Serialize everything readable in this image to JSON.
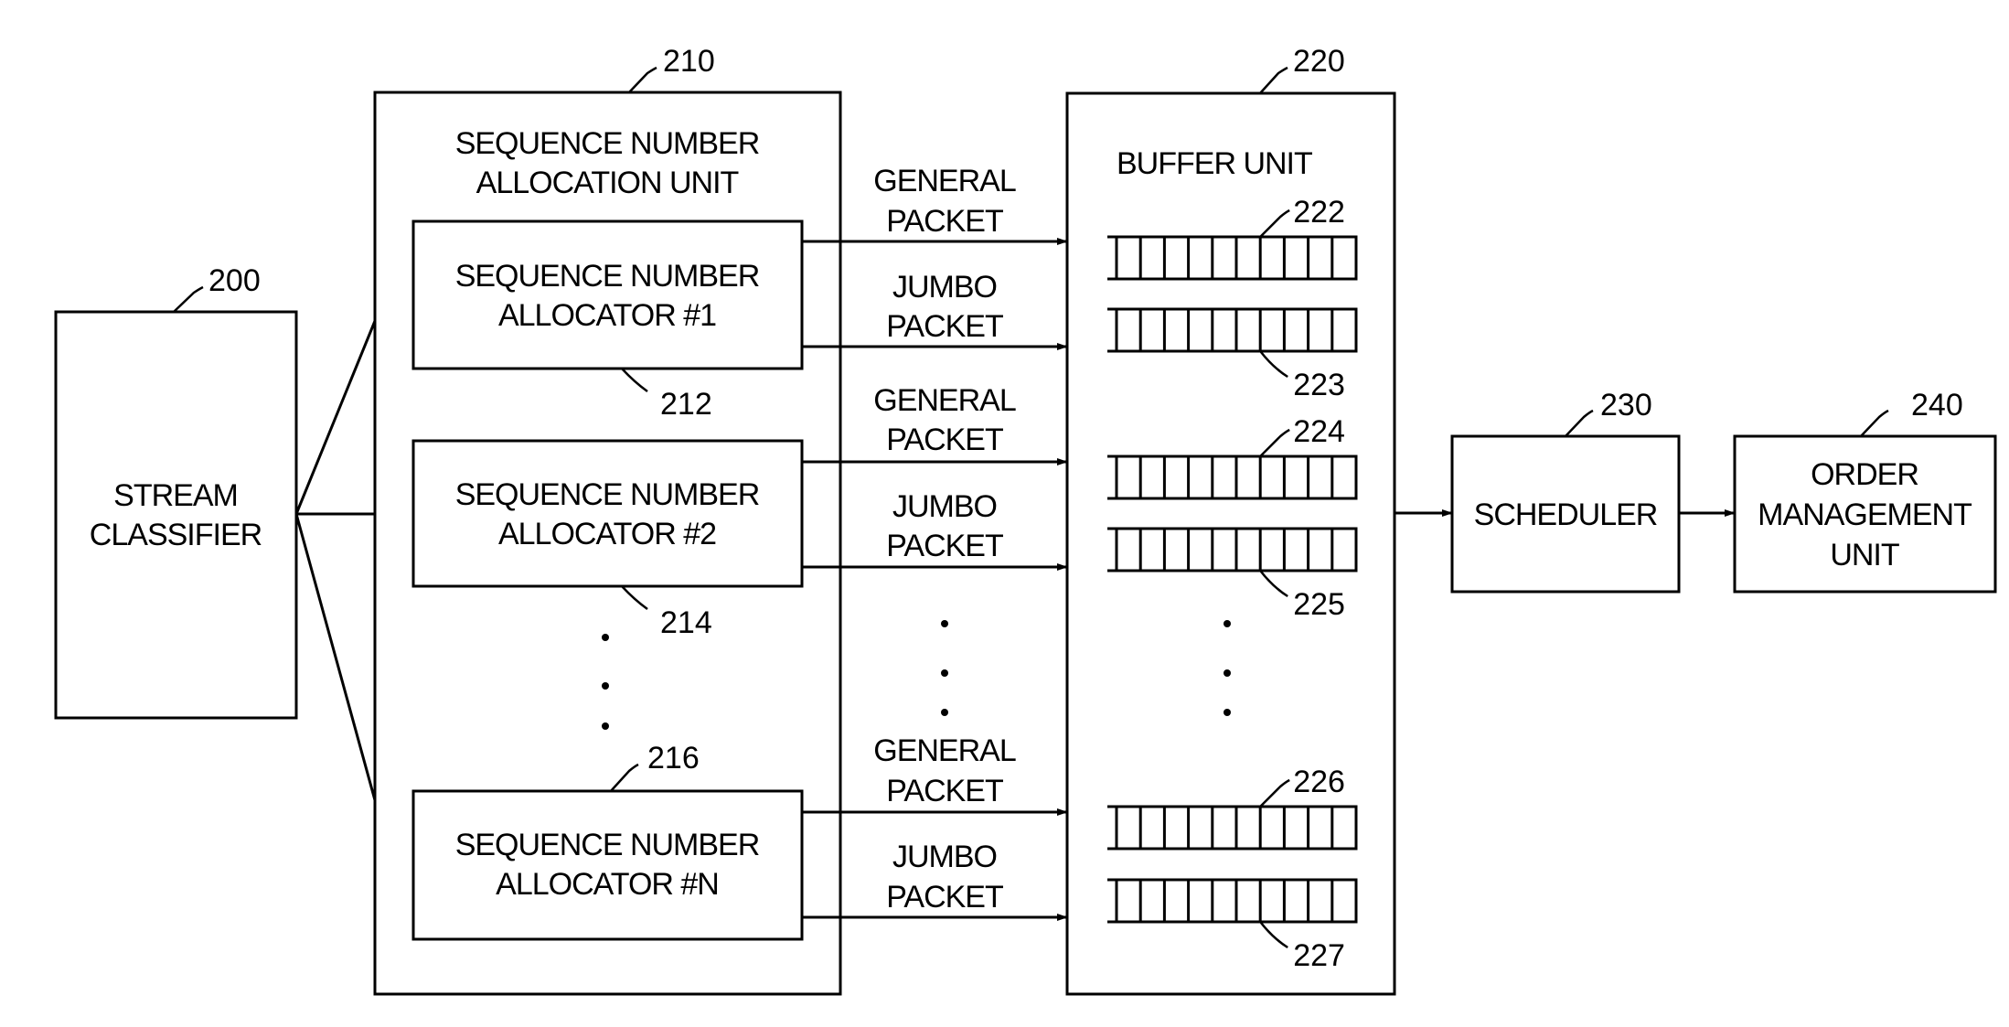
{
  "figure": {
    "blocks": {
      "stream_classifier": {
        "ref": "200",
        "lines": [
          "STREAM",
          "CLASSIFIER"
        ]
      },
      "allocation_unit": {
        "ref": "210",
        "lines": [
          "SEQUENCE NUMBER",
          "ALLOCATION UNIT"
        ]
      },
      "allocators": [
        {
          "ref": "212",
          "lines": [
            "SEQUENCE NUMBER",
            "ALLOCATOR #1"
          ]
        },
        {
          "ref": "214",
          "lines": [
            "SEQUENCE NUMBER",
            "ALLOCATOR #2"
          ]
        },
        {
          "ref": "216",
          "lines": [
            "SEQUENCE NUMBER",
            "ALLOCATOR #N"
          ]
        }
      ],
      "buffer_unit": {
        "ref": "220",
        "lines": [
          "BUFFER UNIT"
        ]
      },
      "queues": [
        {
          "ref": "222",
          "type": "general"
        },
        {
          "ref": "223",
          "type": "jumbo"
        },
        {
          "ref": "224",
          "type": "general"
        },
        {
          "ref": "225",
          "type": "jumbo"
        },
        {
          "ref": "226",
          "type": "general"
        },
        {
          "ref": "227",
          "type": "jumbo"
        }
      ],
      "queue_cells": 10,
      "scheduler": {
        "ref": "230",
        "lines": [
          "SCHEDULER"
        ]
      },
      "order_management": {
        "ref": "240",
        "lines": [
          "ORDER",
          "MANAGEMENT",
          "UNIT"
        ]
      }
    },
    "packet_labels": {
      "general": [
        "GENERAL",
        "PACKET"
      ],
      "jumbo": [
        "JUMBO",
        "PACKET"
      ]
    },
    "ellipsis": "•"
  }
}
